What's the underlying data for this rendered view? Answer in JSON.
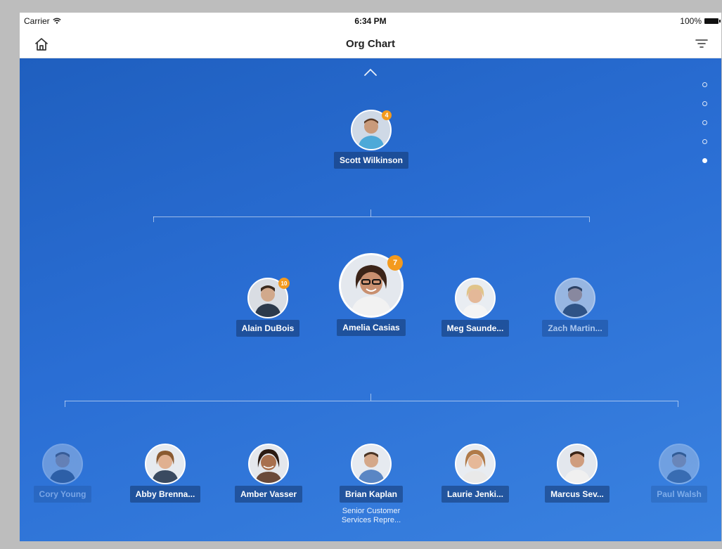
{
  "status": {
    "carrier": "Carrier",
    "time": "6:34 PM",
    "battery": "100%"
  },
  "nav": {
    "title": "Org Chart",
    "home_icon": "home-icon",
    "filter_icon": "filter-icon"
  },
  "pager": {
    "count": 5,
    "active_index": 4
  },
  "manager": {
    "name": "Scott Wilkinson",
    "badge": "4"
  },
  "peers": [
    {
      "name": "Alain DuBois",
      "badge": "10"
    },
    {
      "name": "Amelia Casias",
      "badge": "7"
    },
    {
      "name": "Meg Saunde..."
    },
    {
      "name": "Zach Martin..."
    }
  ],
  "reports": [
    {
      "name": "Cory Young"
    },
    {
      "name": "Abby Brenna..."
    },
    {
      "name": "Amber Vasser"
    },
    {
      "name": "Brian Kaplan",
      "subtitle_line1": "Senior Customer",
      "subtitle_line2": "Services Repre..."
    },
    {
      "name": "Laurie Jenki..."
    },
    {
      "name": "Marcus Sev..."
    },
    {
      "name": "Paul Walsh"
    }
  ],
  "colors": {
    "badge": "#f39a1e",
    "background_start": "#1f5fbf",
    "background_end": "#3a82e0"
  }
}
